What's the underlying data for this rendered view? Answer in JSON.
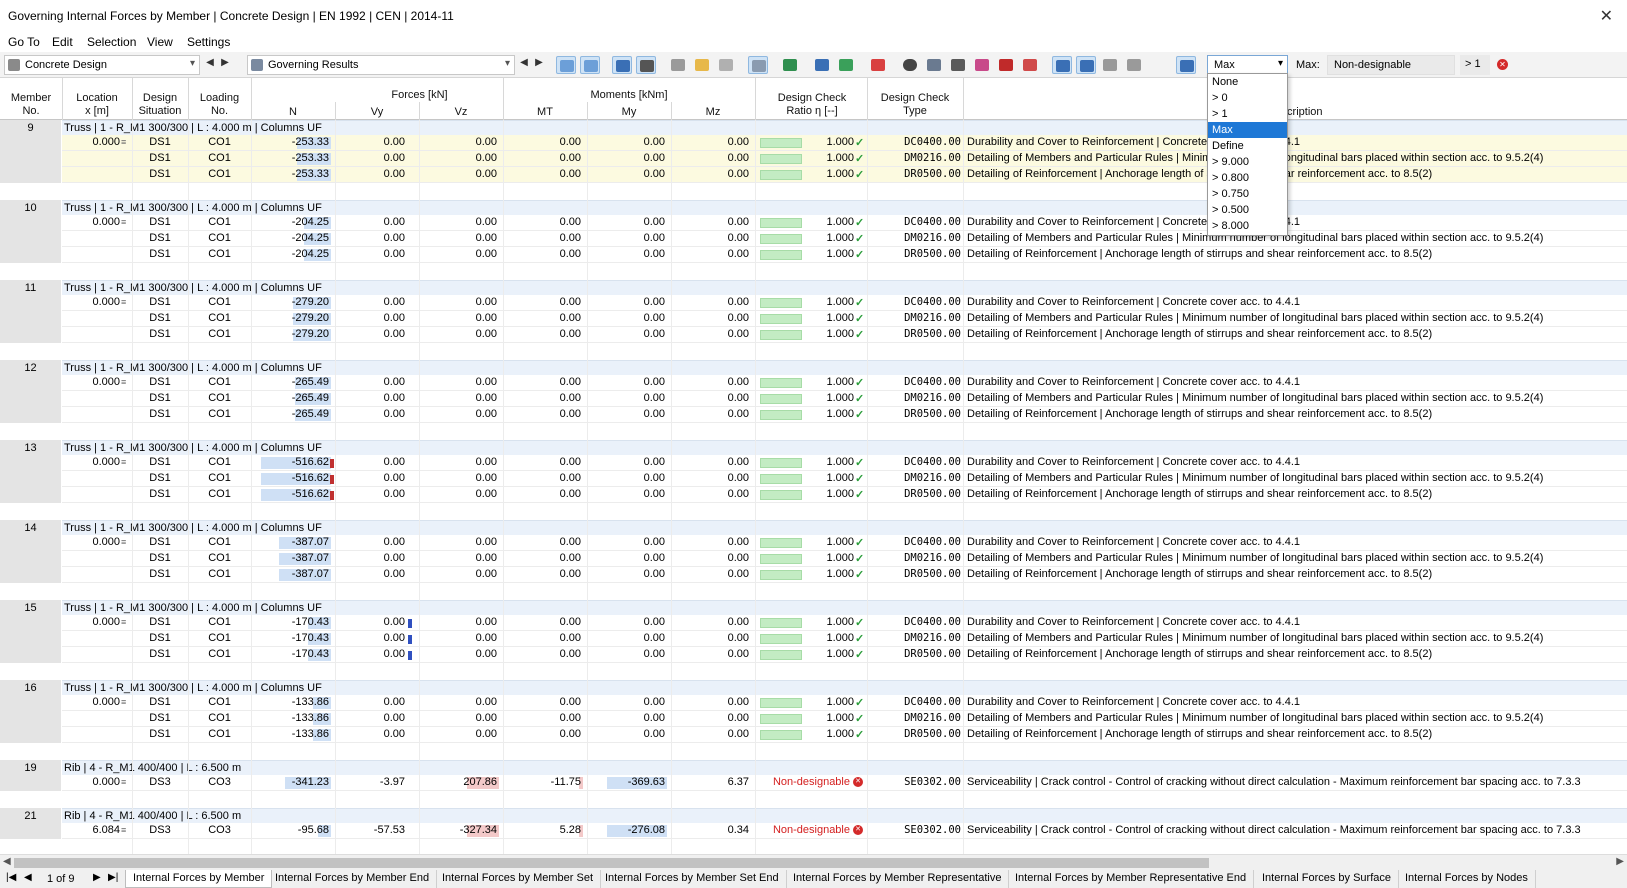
{
  "window": {
    "title": "Governing Internal Forces by Member | Concrete Design | EN 1992 | CEN | 2014-11"
  },
  "menu": [
    "Go To",
    "Edit",
    "Selection",
    "View",
    "Settings"
  ],
  "toolbar": {
    "module": "Concrete Design",
    "result_type": "Governing Results",
    "filter_value": "Max",
    "max_label": "Max:",
    "status_value": "Non-designable",
    "ratio_value": "> 1"
  },
  "dropdown": {
    "options": [
      "None",
      "> 0",
      "> 1",
      "Max",
      "Define",
      "> 9.000",
      "> 0.800",
      "> 0.750",
      "> 0.500",
      "> 8.000"
    ],
    "selected": "Max"
  },
  "headers": {
    "member_no": [
      "Member",
      "No."
    ],
    "location": [
      "Location",
      "x [m]"
    ],
    "design_situation": [
      "Design",
      "Situation"
    ],
    "loading_no": [
      "Loading",
      "No."
    ],
    "forces_group": "Forces [kN]",
    "moments_group": "Moments [kNm]",
    "n": "N",
    "vy": "Vy",
    "vz": "Vz",
    "mt": "MT",
    "my": "My",
    "mz": "Mz",
    "design_check_ratio": [
      "Design Check",
      "Ratio η [--]"
    ],
    "design_check_type": [
      "Design Check",
      "Type"
    ],
    "description": "Description"
  },
  "groups": [
    {
      "no": "9",
      "label": "Truss | 1 - R_M1 300/300 | L : 4.000 m | Columns UF",
      "highlight": true,
      "rows": [
        {
          "x": "0.000",
          "ds": "DS1",
          "co": "CO1",
          "n": "-253.33",
          "vy": "0.00",
          "vz": "0.00",
          "mt": "0.00",
          "my": "0.00",
          "mz": "0.00",
          "ratio": "1.000",
          "type": "DC0400.00",
          "desc": "Durability and Cover to Reinforcement | Concrete cover acc. to 4.4.1"
        },
        {
          "x": "",
          "ds": "DS1",
          "co": "CO1",
          "n": "-253.33",
          "vy": "0.00",
          "vz": "0.00",
          "mt": "0.00",
          "my": "0.00",
          "mz": "0.00",
          "ratio": "1.000",
          "type": "DM0216.00",
          "desc": "Detailing of Members and Particular Rules | Minimum number of longitudinal bars placed within section acc. to 9.5.2(4)"
        },
        {
          "x": "",
          "ds": "DS1",
          "co": "CO1",
          "n": "-253.33",
          "vy": "0.00",
          "vz": "0.00",
          "mt": "0.00",
          "my": "0.00",
          "mz": "0.00",
          "ratio": "1.000",
          "type": "DR0500.00",
          "desc": "Detailing of Reinforcement | Anchorage length of stirrups and shear reinforcement acc. to 8.5(2)"
        }
      ]
    },
    {
      "no": "10",
      "label": "Truss | 1 - R_M1 300/300 | L : 4.000 m | Columns UF",
      "rows": [
        {
          "x": "0.000",
          "ds": "DS1",
          "co": "CO1",
          "n": "-204.25",
          "vy": "0.00",
          "vz": "0.00",
          "mt": "0.00",
          "my": "0.00",
          "mz": "0.00",
          "ratio": "1.000",
          "type": "DC0400.00",
          "desc": "Durability and Cover to Reinforcement | Concrete cover acc. to 4.4.1"
        },
        {
          "x": "",
          "ds": "DS1",
          "co": "CO1",
          "n": "-204.25",
          "vy": "0.00",
          "vz": "0.00",
          "mt": "0.00",
          "my": "0.00",
          "mz": "0.00",
          "ratio": "1.000",
          "type": "DM0216.00",
          "desc": "Detailing of Members and Particular Rules | Minimum number of longitudinal bars placed within section acc. to 9.5.2(4)"
        },
        {
          "x": "",
          "ds": "DS1",
          "co": "CO1",
          "n": "-204.25",
          "vy": "0.00",
          "vz": "0.00",
          "mt": "0.00",
          "my": "0.00",
          "mz": "0.00",
          "ratio": "1.000",
          "type": "DR0500.00",
          "desc": "Detailing of Reinforcement | Anchorage length of stirrups and shear reinforcement acc. to 8.5(2)"
        }
      ]
    },
    {
      "no": "11",
      "label": "Truss | 1 - R_M1 300/300 | L : 4.000 m | Columns UF",
      "rows": [
        {
          "x": "0.000",
          "ds": "DS1",
          "co": "CO1",
          "n": "-279.20",
          "vy": "0.00",
          "vz": "0.00",
          "mt": "0.00",
          "my": "0.00",
          "mz": "0.00",
          "ratio": "1.000",
          "type": "DC0400.00",
          "desc": "Durability and Cover to Reinforcement | Concrete cover acc. to 4.4.1"
        },
        {
          "x": "",
          "ds": "DS1",
          "co": "CO1",
          "n": "-279.20",
          "vy": "0.00",
          "vz": "0.00",
          "mt": "0.00",
          "my": "0.00",
          "mz": "0.00",
          "ratio": "1.000",
          "type": "DM0216.00",
          "desc": "Detailing of Members and Particular Rules | Minimum number of longitudinal bars placed within section acc. to 9.5.2(4)"
        },
        {
          "x": "",
          "ds": "DS1",
          "co": "CO1",
          "n": "-279.20",
          "vy": "0.00",
          "vz": "0.00",
          "mt": "0.00",
          "my": "0.00",
          "mz": "0.00",
          "ratio": "1.000",
          "type": "DR0500.00",
          "desc": "Detailing of Reinforcement | Anchorage length of stirrups and shear reinforcement acc. to 8.5(2)"
        }
      ]
    },
    {
      "no": "12",
      "label": "Truss | 1 - R_M1 300/300 | L : 4.000 m | Columns UF",
      "rows": [
        {
          "x": "0.000",
          "ds": "DS1",
          "co": "CO1",
          "n": "-265.49",
          "vy": "0.00",
          "vz": "0.00",
          "mt": "0.00",
          "my": "0.00",
          "mz": "0.00",
          "ratio": "1.000",
          "type": "DC0400.00",
          "desc": "Durability and Cover to Reinforcement | Concrete cover acc. to 4.4.1"
        },
        {
          "x": "",
          "ds": "DS1",
          "co": "CO1",
          "n": "-265.49",
          "vy": "0.00",
          "vz": "0.00",
          "mt": "0.00",
          "my": "0.00",
          "mz": "0.00",
          "ratio": "1.000",
          "type": "DM0216.00",
          "desc": "Detailing of Members and Particular Rules | Minimum number of longitudinal bars placed within section acc. to 9.5.2(4)"
        },
        {
          "x": "",
          "ds": "DS1",
          "co": "CO1",
          "n": "-265.49",
          "vy": "0.00",
          "vz": "0.00",
          "mt": "0.00",
          "my": "0.00",
          "mz": "0.00",
          "ratio": "1.000",
          "type": "DR0500.00",
          "desc": "Detailing of Reinforcement | Anchorage length of stirrups and shear reinforcement acc. to 8.5(2)"
        }
      ]
    },
    {
      "no": "13",
      "label": "Truss | 1 - R_M1 300/300 | L : 4.000 m | Columns UF",
      "rows": [
        {
          "x": "0.000",
          "ds": "DS1",
          "co": "CO1",
          "n": "-516.62",
          "vy": "0.00",
          "vz": "0.00",
          "mt": "0.00",
          "my": "0.00",
          "mz": "0.00",
          "ratio": "1.000",
          "type": "DC0400.00",
          "desc": "Durability and Cover to Reinforcement | Concrete cover acc. to 4.4.1"
        },
        {
          "x": "",
          "ds": "DS1",
          "co": "CO1",
          "n": "-516.62",
          "vy": "0.00",
          "vz": "0.00",
          "mt": "0.00",
          "my": "0.00",
          "mz": "0.00",
          "ratio": "1.000",
          "type": "DM0216.00",
          "desc": "Detailing of Members and Particular Rules | Minimum number of longitudinal bars placed within section acc. to 9.5.2(4)"
        },
        {
          "x": "",
          "ds": "DS1",
          "co": "CO1",
          "n": "-516.62",
          "vy": "0.00",
          "vz": "0.00",
          "mt": "0.00",
          "my": "0.00",
          "mz": "0.00",
          "ratio": "1.000",
          "type": "DR0500.00",
          "desc": "Detailing of Reinforcement | Anchorage length of stirrups and shear reinforcement acc. to 8.5(2)"
        }
      ]
    },
    {
      "no": "14",
      "label": "Truss | 1 - R_M1 300/300 | L : 4.000 m | Columns UF",
      "rows": [
        {
          "x": "0.000",
          "ds": "DS1",
          "co": "CO1",
          "n": "-387.07",
          "vy": "0.00",
          "vz": "0.00",
          "mt": "0.00",
          "my": "0.00",
          "mz": "0.00",
          "ratio": "1.000",
          "type": "DC0400.00",
          "desc": "Durability and Cover to Reinforcement | Concrete cover acc. to 4.4.1"
        },
        {
          "x": "",
          "ds": "DS1",
          "co": "CO1",
          "n": "-387.07",
          "vy": "0.00",
          "vz": "0.00",
          "mt": "0.00",
          "my": "0.00",
          "mz": "0.00",
          "ratio": "1.000",
          "type": "DM0216.00",
          "desc": "Detailing of Members and Particular Rules | Minimum number of longitudinal bars placed within section acc. to 9.5.2(4)"
        },
        {
          "x": "",
          "ds": "DS1",
          "co": "CO1",
          "n": "-387.07",
          "vy": "0.00",
          "vz": "0.00",
          "mt": "0.00",
          "my": "0.00",
          "mz": "0.00",
          "ratio": "1.000",
          "type": "DR0500.00",
          "desc": "Detailing of Reinforcement | Anchorage length of stirrups and shear reinforcement acc. to 8.5(2)"
        }
      ]
    },
    {
      "no": "15",
      "label": "Truss | 1 - R_M1 300/300 | L : 4.000 m | Columns UF",
      "rows": [
        {
          "x": "0.000",
          "ds": "DS1",
          "co": "CO1",
          "n": "-170.43",
          "vy": "0.00",
          "vz": "0.00",
          "mt": "0.00",
          "my": "0.00",
          "mz": "0.00",
          "ratio": "1.000",
          "type": "DC0400.00",
          "desc": "Durability and Cover to Reinforcement | Concrete cover acc. to 4.4.1"
        },
        {
          "x": "",
          "ds": "DS1",
          "co": "CO1",
          "n": "-170.43",
          "vy": "0.00",
          "vz": "0.00",
          "mt": "0.00",
          "my": "0.00",
          "mz": "0.00",
          "ratio": "1.000",
          "type": "DM0216.00",
          "desc": "Detailing of Members and Particular Rules | Minimum number of longitudinal bars placed within section acc. to 9.5.2(4)"
        },
        {
          "x": "",
          "ds": "DS1",
          "co": "CO1",
          "n": "-170.43",
          "vy": "0.00",
          "vz": "0.00",
          "mt": "0.00",
          "my": "0.00",
          "mz": "0.00",
          "ratio": "1.000",
          "type": "DR0500.00",
          "desc": "Detailing of Reinforcement | Anchorage length of stirrups and shear reinforcement acc. to 8.5(2)"
        }
      ]
    },
    {
      "no": "16",
      "label": "Truss | 1 - R_M1 300/300 | L : 4.000 m | Columns UF",
      "rows": [
        {
          "x": "0.000",
          "ds": "DS1",
          "co": "CO1",
          "n": "-133.86",
          "vy": "0.00",
          "vz": "0.00",
          "mt": "0.00",
          "my": "0.00",
          "mz": "0.00",
          "ratio": "1.000",
          "type": "DC0400.00",
          "desc": "Durability and Cover to Reinforcement | Concrete cover acc. to 4.4.1"
        },
        {
          "x": "",
          "ds": "DS1",
          "co": "CO1",
          "n": "-133.86",
          "vy": "0.00",
          "vz": "0.00",
          "mt": "0.00",
          "my": "0.00",
          "mz": "0.00",
          "ratio": "1.000",
          "type": "DM0216.00",
          "desc": "Detailing of Members and Particular Rules | Minimum number of longitudinal bars placed within section acc. to 9.5.2(4)"
        },
        {
          "x": "",
          "ds": "DS1",
          "co": "CO1",
          "n": "-133.86",
          "vy": "0.00",
          "vz": "0.00",
          "mt": "0.00",
          "my": "0.00",
          "mz": "0.00",
          "ratio": "1.000",
          "type": "DR0500.00",
          "desc": "Detailing of Reinforcement | Anchorage length of stirrups and shear reinforcement acc. to 8.5(2)"
        }
      ]
    },
    {
      "no": "19",
      "label": "Rib | 4 - R_M1 400/400 | L : 6.500 m",
      "rows": [
        {
          "x": "0.000",
          "ds": "DS3",
          "co": "CO3",
          "n": "-341.23",
          "vy": "-3.97",
          "vz": "207.86",
          "mt": "-11.75",
          "my": "-369.63",
          "mz": "6.37",
          "ratio": "Non-designable",
          "type": "SE0302.00",
          "desc": "Serviceability | Crack control - Control of cracking without direct calculation - Maximum reinforcement bar spacing acc. to 7.3.3"
        }
      ]
    },
    {
      "no": "21",
      "label": "Rib | 4 - R_M1 400/400 | L : 6.500 m",
      "rows": [
        {
          "x": "6.084",
          "ds": "DS3",
          "co": "CO3",
          "n": "-95.68",
          "vy": "-57.53",
          "vz": "-327.34",
          "mt": "5.28",
          "my": "-276.08",
          "mz": "0.34",
          "ratio": "Non-designable",
          "type": "SE0302.00",
          "desc": "Serviceability | Crack control - Control of cracking without direct calculation - Maximum reinforcement bar spacing acc. to 7.3.3"
        }
      ]
    }
  ],
  "pagination": {
    "text": "1 of 9"
  },
  "tabs": [
    "Internal Forces by Member",
    "Internal Forces by Member End",
    "Internal Forces by Member Set",
    "Internal Forces by Member Set End",
    "Internal Forces by Member Representative",
    "Internal Forces by Member Representative End",
    "Internal Forces by Surface",
    "Internal Forces by Nodes"
  ],
  "colors": {
    "accent": "#1e78d6",
    "error": "#d42a2a",
    "ok": "#2a9d3a",
    "group_bg": "#eaf1fa",
    "highlight": "#fcfae0"
  }
}
